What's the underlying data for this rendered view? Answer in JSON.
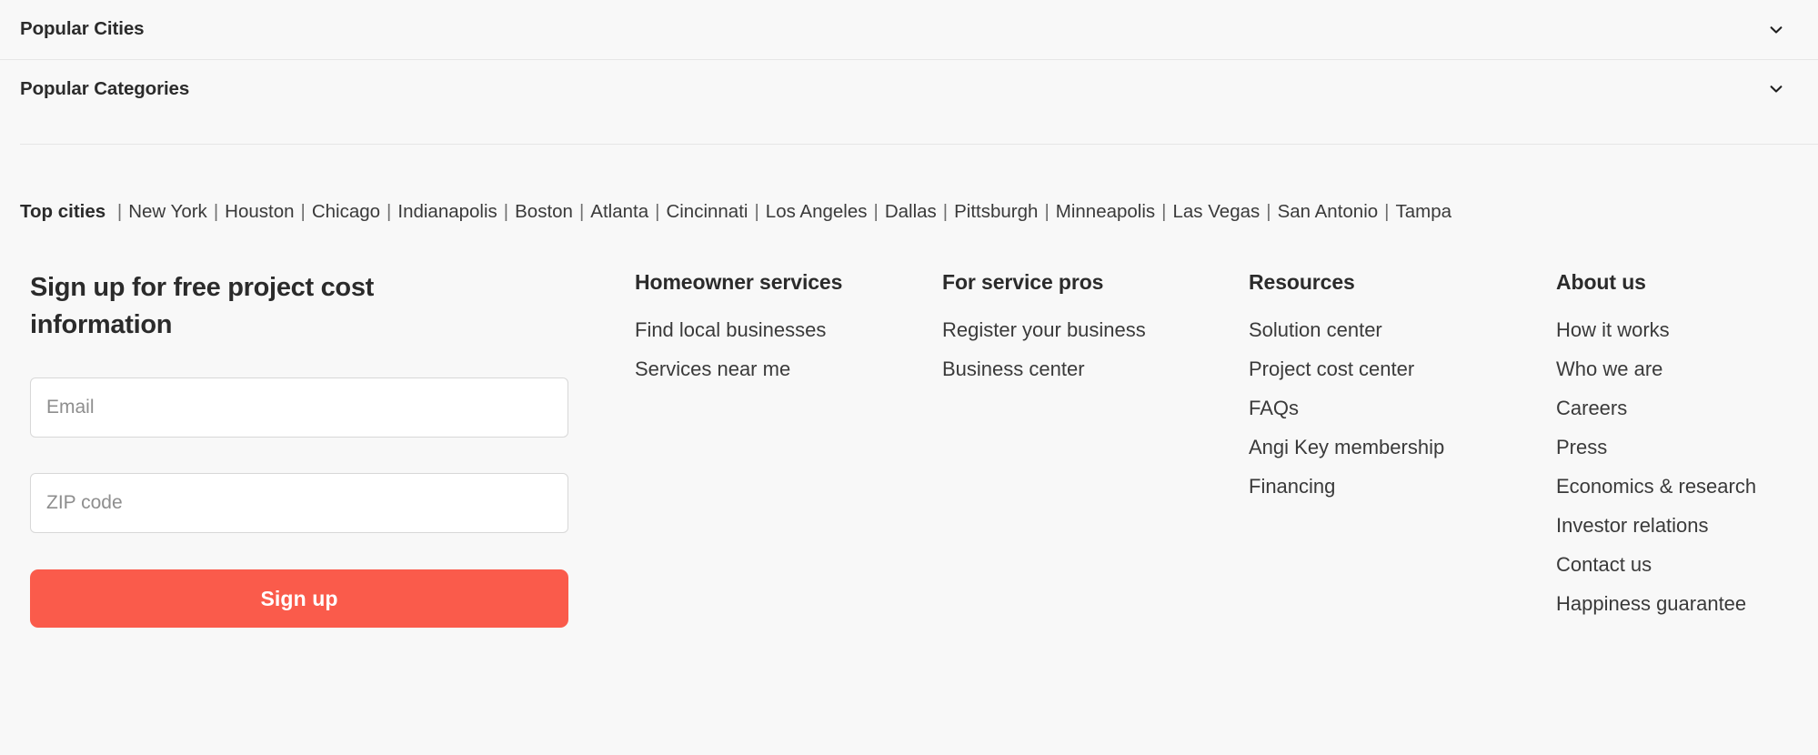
{
  "accordion": {
    "rows": [
      {
        "label": "Popular Cities",
        "icon": "chevron-down-icon"
      },
      {
        "label": "Popular Categories",
        "icon": "chevron-down-icon"
      }
    ]
  },
  "top_cities": {
    "label": "Top cities",
    "separator": "|",
    "cities": [
      "New York",
      "Houston",
      "Chicago",
      "Indianapolis",
      "Boston",
      "Atlanta",
      "Cincinnati",
      "Los Angeles",
      "Dallas",
      "Pittsburgh",
      "Minneapolis",
      "Las Vegas",
      "San Antonio",
      "Tampa"
    ]
  },
  "signup": {
    "heading": "Sign up for free project cost information",
    "email": {
      "value": "",
      "placeholder": "Email"
    },
    "zip": {
      "value": "",
      "placeholder": "ZIP code"
    },
    "button_label": "Sign up",
    "button_color": "#fa5b4b"
  },
  "footer_columns": [
    {
      "title": "Homeowner services",
      "links": [
        "Find local businesses",
        "Services near me"
      ]
    },
    {
      "title": "For service pros",
      "links": [
        "Register your business",
        "Business center"
      ]
    },
    {
      "title": "Resources",
      "links": [
        "Solution center",
        "Project cost center",
        "FAQs",
        "Angi Key membership",
        "Financing"
      ]
    },
    {
      "title": "About us",
      "links": [
        "How it works",
        "Who we are",
        "Careers",
        "Press",
        "Economics & research",
        "Investor relations",
        "Contact us",
        "Happiness guarantee"
      ]
    }
  ],
  "colors": {
    "page_background": "#f8f8f8",
    "text": "#2b2b2b",
    "link": "#3a3a3a",
    "divider": "#e6e6e6",
    "accent": "#fa5b4b",
    "input_border": "#d8d8d8",
    "placeholder": "#8e8e8e"
  }
}
